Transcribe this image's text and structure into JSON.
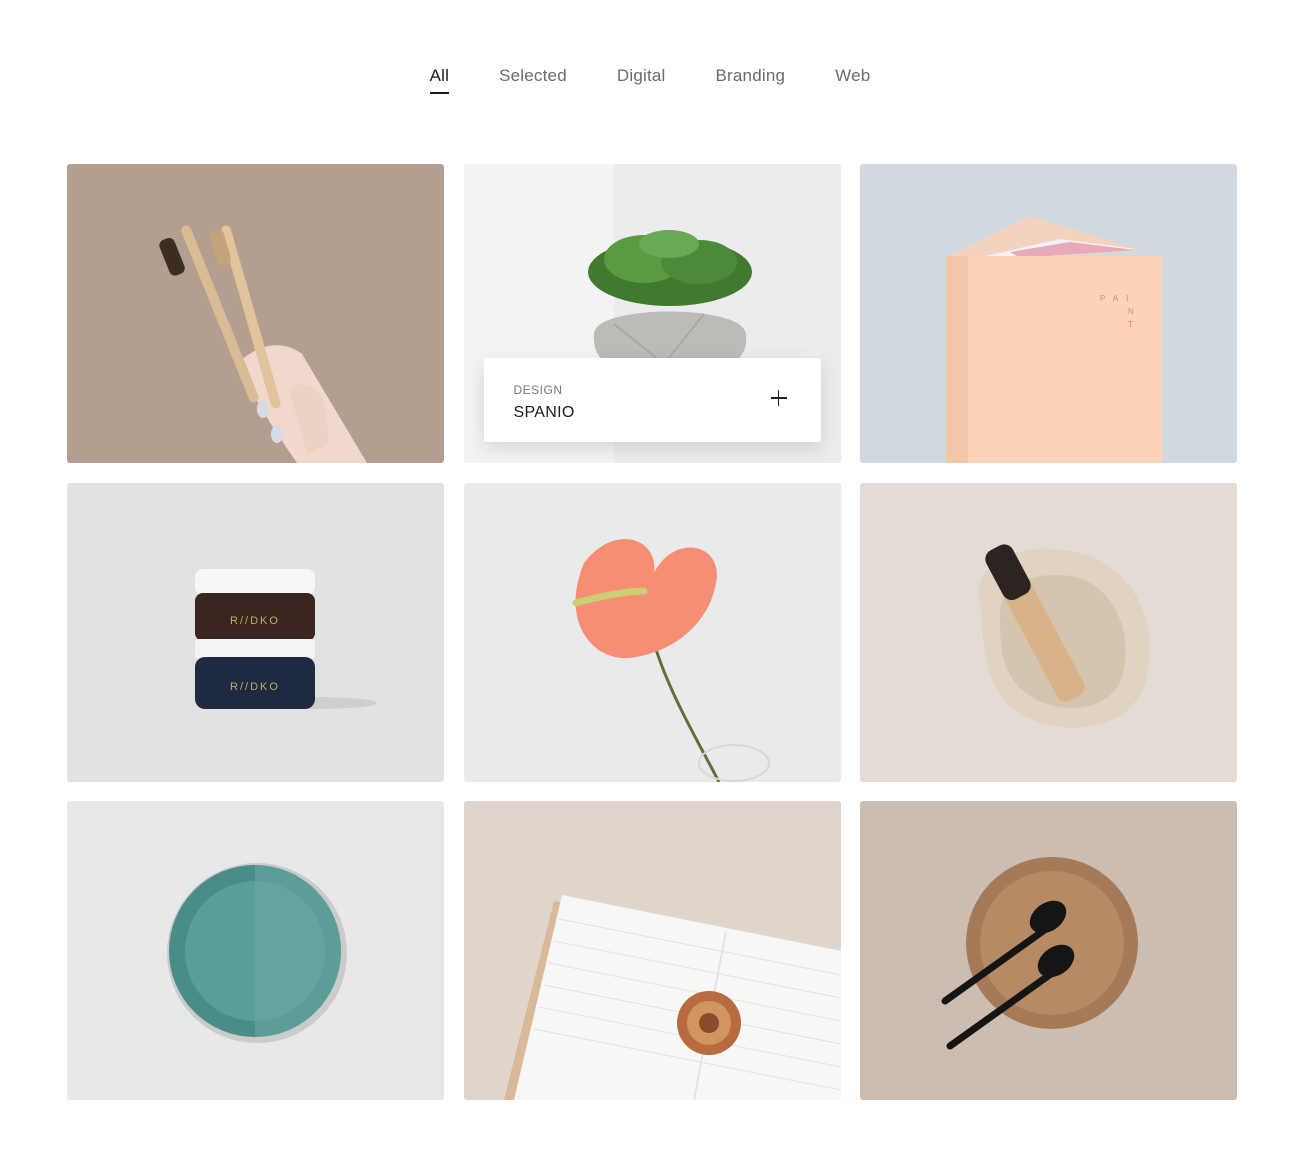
{
  "filters": [
    "All",
    "Selected",
    "Digital",
    "Branding",
    "Web"
  ],
  "active_filter": "All",
  "featured_overlay": {
    "category": "DESIGN",
    "title": "SPANIO"
  },
  "jar_label": "R//DKO",
  "book_label": "PAINT",
  "colors": {
    "active_text": "#1a1a1a",
    "inactive_text": "#6b6b6b"
  }
}
